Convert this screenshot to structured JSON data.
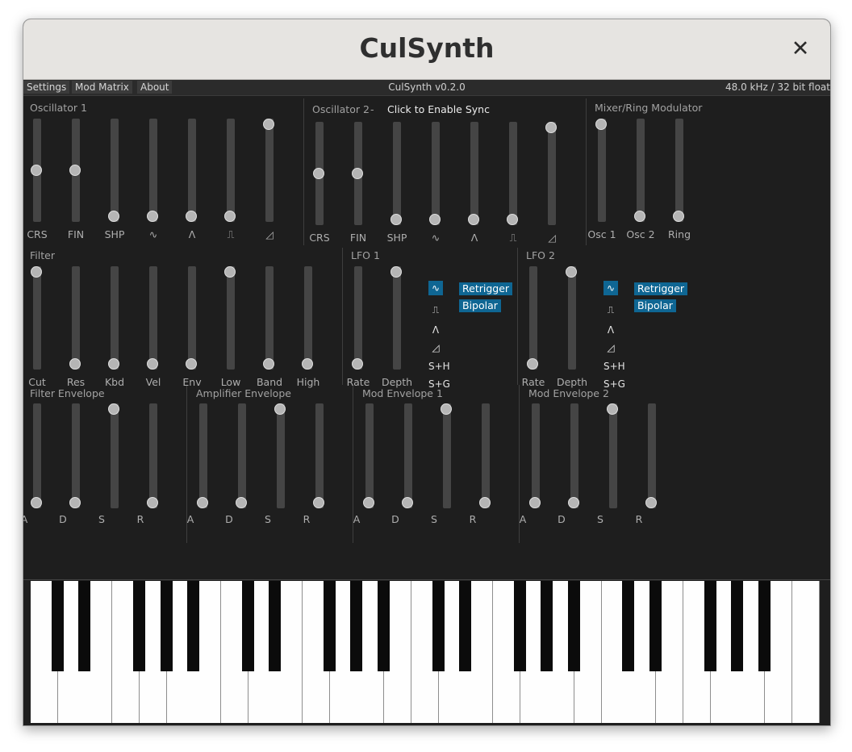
{
  "window": {
    "title": "CulSynth",
    "close_glyph": "✕"
  },
  "menu": {
    "settings": "Settings",
    "mod_matrix": "Mod Matrix",
    "about": "About",
    "version": "CulSynth v0.2.0",
    "sample_rate": "48.0 kHz / 32 bit float"
  },
  "oscillator1": {
    "title": "Oscillator 1",
    "labels": [
      "CRS",
      "FIN",
      "SHP",
      "∿",
      "Λ",
      "⎍",
      "◿"
    ],
    "values": [
      0.5,
      0.5,
      0,
      0,
      0,
      0,
      1
    ]
  },
  "oscillator2": {
    "title": "Oscillator 2",
    "dash": "-",
    "sync_label": "Click to Enable Sync",
    "labels": [
      "CRS",
      "FIN",
      "SHP",
      "∿",
      "Λ",
      "⎍",
      "◿"
    ],
    "values": [
      0.5,
      0.5,
      0,
      0,
      0,
      0,
      1
    ]
  },
  "mixer": {
    "title": "Mixer/Ring Modulator",
    "labels": [
      "Osc 1",
      "Osc 2",
      "Ring"
    ],
    "values": [
      1,
      0,
      0
    ]
  },
  "filter": {
    "title": "Filter",
    "labels": [
      "Cut",
      "Res",
      "Kbd",
      "Vel",
      "Env",
      "Low",
      "Band",
      "High"
    ],
    "values": [
      1,
      0,
      0,
      0,
      0,
      1,
      0,
      0
    ]
  },
  "lfo1": {
    "title": "LFO 1",
    "labels": [
      "Rate",
      "Depth"
    ],
    "values": [
      0,
      1
    ],
    "waves": [
      "∿",
      "⎍",
      "Λ",
      "◿",
      "S+H",
      "S+G"
    ],
    "selected_wave": 0,
    "retrigger": "Retrigger",
    "bipolar": "Bipolar"
  },
  "lfo2": {
    "title": "LFO 2",
    "labels": [
      "Rate",
      "Depth"
    ],
    "values": [
      0,
      1
    ],
    "waves": [
      "∿",
      "⎍",
      "Λ",
      "◿",
      "S+H",
      "S+G"
    ],
    "selected_wave": 0,
    "retrigger": "Retrigger",
    "bipolar": "Bipolar"
  },
  "envelopes": [
    {
      "title": "Filter Envelope",
      "labels": [
        "A",
        "D",
        "S",
        "R"
      ],
      "values": [
        0,
        0,
        1,
        0
      ]
    },
    {
      "title": "Amplifier Envelope",
      "labels": [
        "A",
        "D",
        "S",
        "R"
      ],
      "values": [
        0,
        0,
        1,
        0
      ]
    },
    {
      "title": "Mod Envelope 1",
      "labels": [
        "A",
        "D",
        "S",
        "R"
      ],
      "values": [
        0,
        0,
        1,
        0
      ]
    },
    {
      "title": "Mod Envelope 2",
      "labels": [
        "A",
        "D",
        "S",
        "R"
      ],
      "values": [
        0,
        0,
        1,
        0
      ]
    }
  ],
  "keyboard": {
    "white_keys": 29
  }
}
